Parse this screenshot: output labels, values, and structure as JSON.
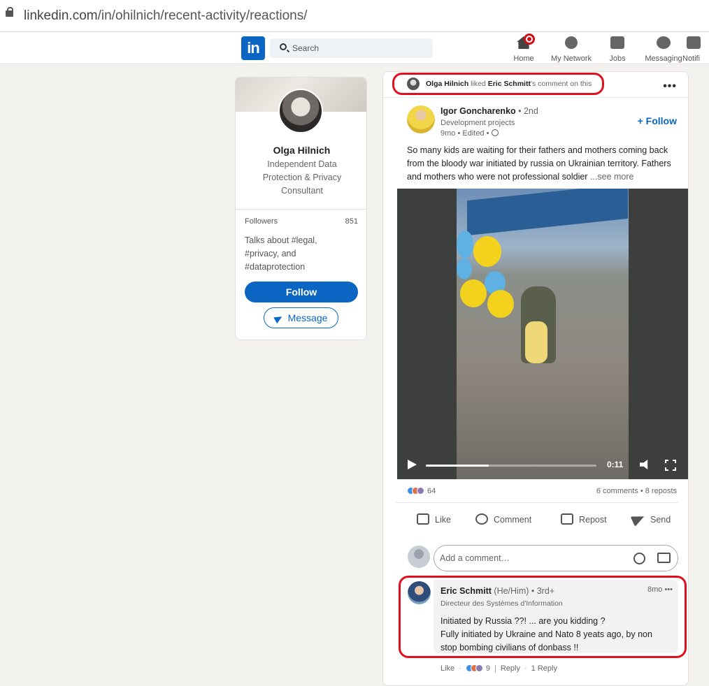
{
  "browser": {
    "url_host": "linkedin.com",
    "url_path": "/in/ohilnich/recent-activity/reactions/"
  },
  "nav": {
    "logo": "in",
    "search_placeholder": "Search",
    "items": [
      {
        "label": "Home",
        "icon": "home-icon"
      },
      {
        "label": "My Network",
        "icon": "network-icon"
      },
      {
        "label": "Jobs",
        "icon": "jobs-icon"
      },
      {
        "label": "Messaging",
        "icon": "messaging-icon"
      },
      {
        "label": "Notifi",
        "icon": "notifications-icon"
      }
    ]
  },
  "profile": {
    "name": "Olga Hilnich",
    "headline": "Independent Data Protection & Privacy Consultant",
    "followers_label": "Followers",
    "followers_count": "851",
    "talks_about": "Talks about #legal, #privacy, and #dataprotection",
    "follow_label": "Follow",
    "message_label": "Message"
  },
  "activity": {
    "actor": "Olga Hilnich",
    "verb": " liked ",
    "target": "Eric Schmitt",
    "suffix": "'s comment on this"
  },
  "post": {
    "author": "Igor Goncharenko",
    "degree": " • 2nd",
    "subtitle": "Development projects",
    "meta": "9mo • Edited • ",
    "follow_label": "+ Follow",
    "text": "So many kids are waiting for their fathers and mothers coming back from the bloody war initiated by russia on Ukrainian territory. Fathers and mothers who were not professional soldier ",
    "see_more": "...see more",
    "video": {
      "time": "0:11",
      "progress": 0.37
    },
    "reaction_count": "64",
    "counts": "6 comments • 8 reposts",
    "actions": [
      "Like",
      "Comment",
      "Repost",
      "Send"
    ],
    "comment_placeholder": "Add a comment…"
  },
  "comment": {
    "author": "Eric Schmitt",
    "pronouns": " (He/Him) • 3rd+",
    "title": "Directeur des Systèmes d'Information",
    "time": "8mo",
    "more": "•••",
    "line1": "Initiated by Russia ??! ... are you kidding ?",
    "line2": "Fully initiated by Ukraine and Nato 8 yeats ago, by non stop bombing civilians of donbass !!",
    "like_label": "Like",
    "like_count": "9",
    "reply_label": "Reply",
    "replies": "1 Reply"
  },
  "colors": {
    "brand": "#0a66c2",
    "highlight": "#e0101c"
  }
}
